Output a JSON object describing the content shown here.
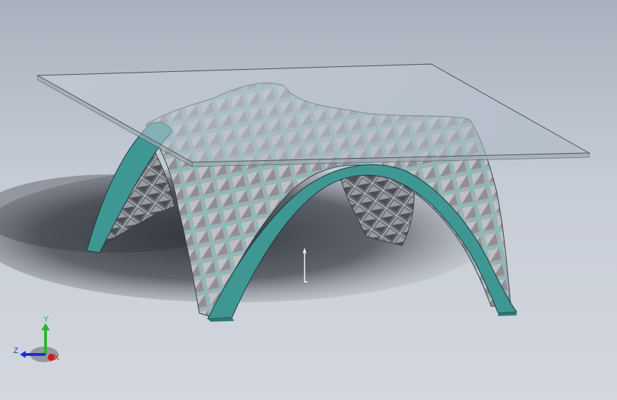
{
  "viewport": {
    "background_top": "#aab0bd",
    "background_bottom": "#d3d8df"
  },
  "model": {
    "description_icon": "arched-gridshell-table-model",
    "glass_color": "#b8c6d2",
    "arch_edge_color": "#3f9793",
    "grid_color": "#62cfc7",
    "panel_color": "#a9abb0"
  },
  "triad": {
    "x_label": "X",
    "y_label": "Y",
    "z_label": "Z",
    "x_color": "#d21b1b",
    "y_color": "#2bb43a",
    "z_color": "#1f2fc8"
  },
  "cursor": {
    "icon": "mouse-pointer-icon"
  }
}
